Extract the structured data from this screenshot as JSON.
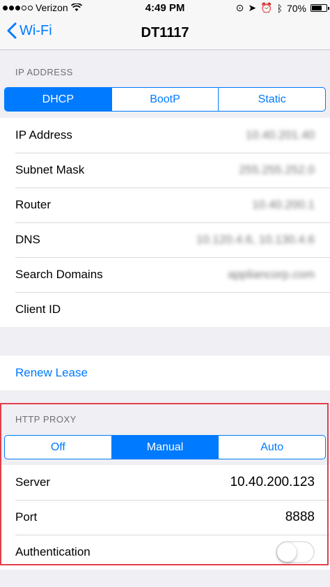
{
  "status_bar": {
    "carrier": "Verizon",
    "time": "4:49 PM",
    "battery": "70%",
    "battery_level": 0.7,
    "signal_bars": 3,
    "signal_total": 5
  },
  "nav": {
    "back_label": "Wi-Fi",
    "title": "DT1117"
  },
  "ip_section": {
    "header": "IP ADDRESS",
    "segments": [
      "DHCP",
      "BootP",
      "Static"
    ],
    "selected": 0,
    "rows": [
      {
        "label": "IP Address",
        "value": "10.40.201.40"
      },
      {
        "label": "Subnet Mask",
        "value": "255.255.252.0"
      },
      {
        "label": "Router",
        "value": "10.40.200.1"
      },
      {
        "label": "DNS",
        "value": "10.120.4.6, 10.130.4.6"
      },
      {
        "label": "Search Domains",
        "value": "appliancorp.com"
      },
      {
        "label": "Client ID",
        "value": ""
      }
    ]
  },
  "renew_lease": "Renew Lease",
  "proxy_section": {
    "header": "HTTP PROXY",
    "segments": [
      "Off",
      "Manual",
      "Auto"
    ],
    "selected": 1,
    "server_label": "Server",
    "server_value": "10.40.200.123",
    "port_label": "Port",
    "port_value": "8888",
    "auth_label": "Authentication",
    "auth_enabled": false
  },
  "colors": {
    "accent": "#007aff",
    "highlight_border": "#e33e4a",
    "background": "#efeff4"
  }
}
